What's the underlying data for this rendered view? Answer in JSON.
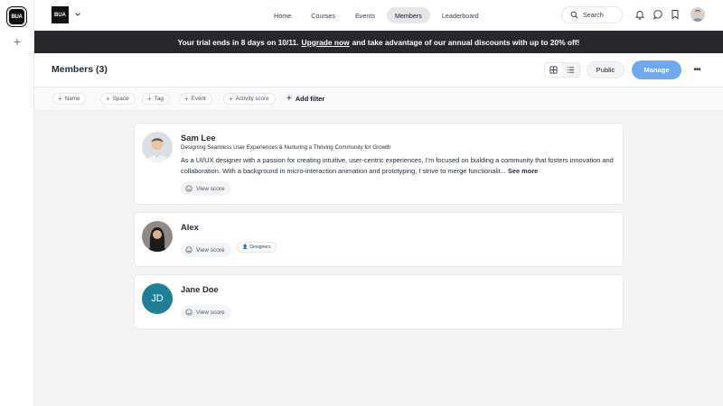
{
  "brand": {
    "logo_text": "BUA"
  },
  "nav": {
    "items": [
      {
        "label": "Home",
        "active": false
      },
      {
        "label": "Courses",
        "active": false
      },
      {
        "label": "Events",
        "active": false
      },
      {
        "label": "Members",
        "active": true
      },
      {
        "label": "Leaderboard",
        "active": false
      }
    ],
    "search_label": "Search"
  },
  "banner": {
    "prefix": "Your trial ends in 8 days on 10/11.",
    "link": "Upgrade now",
    "suffix": "and take advantage of our annual discounts with up to 20% off!"
  },
  "header": {
    "title": "Members (3)",
    "public_label": "Public",
    "manage_label": "Manage",
    "more_label": "•••"
  },
  "filters": {
    "chips": [
      "Name",
      "Space",
      "Tag",
      "Event",
      "Activity score"
    ],
    "add_label": "Add filter"
  },
  "members": [
    {
      "name": "Sam Lee",
      "tagline": "Designing Seamless User Experiences & Nurturing a Thriving Community for Growth",
      "bio": "As a UI/UX designer with a passion for creating intuitive, user-centric experiences, I'm focused on building a community that fosters innovation and collaboration. With a background in micro-interaction animation and prototyping, I strive to merge functionalit...",
      "see_more": "See more",
      "score_label": "View score"
    },
    {
      "name": "Alex",
      "score_label": "View score",
      "tag": "Designers"
    },
    {
      "name": "Jane Doe",
      "initials": "JD",
      "score_label": "View score"
    }
  ],
  "colors": {
    "accent": "#6ea8ee",
    "banner_bg": "#26282b",
    "jd_avatar": "#1f7f97"
  }
}
